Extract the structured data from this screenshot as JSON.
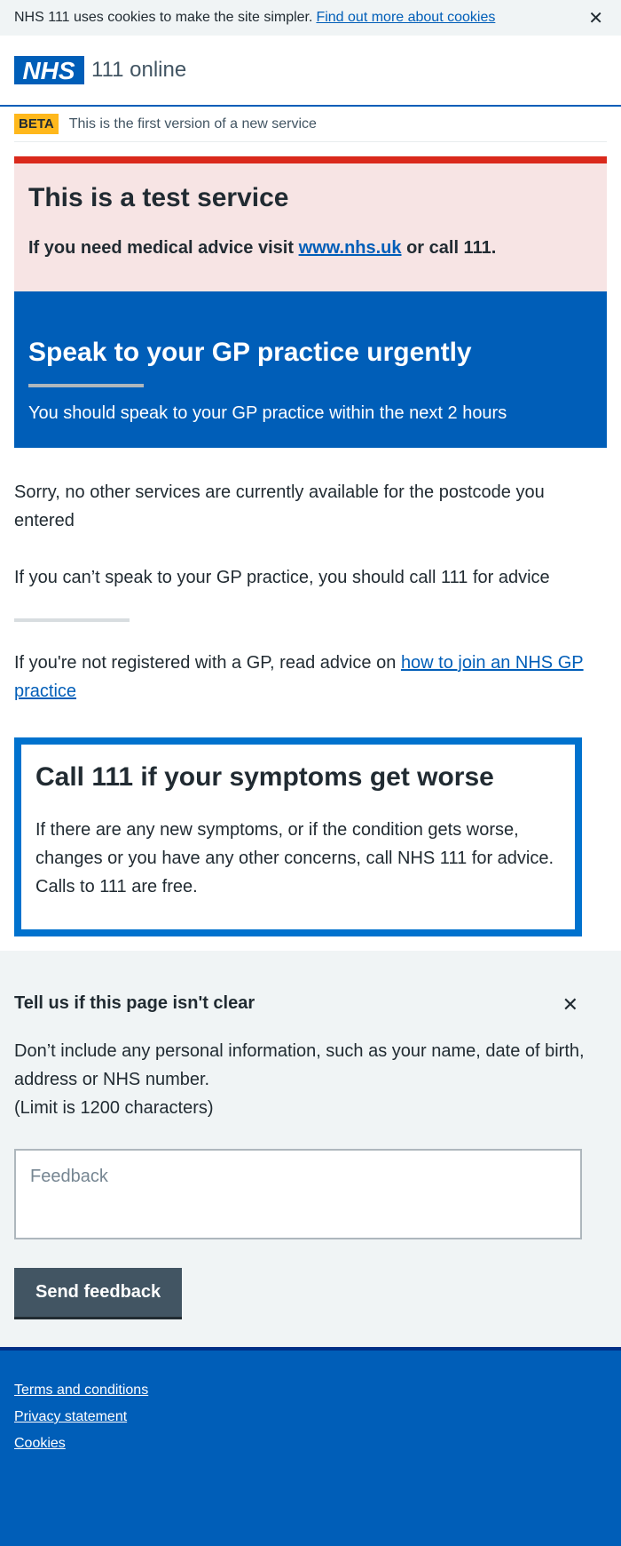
{
  "cookie_banner": {
    "text": "NHS 111 uses cookies to make the site simpler.",
    "link": "Find out more about cookies",
    "close": "✕"
  },
  "header": {
    "logo_text": "NHS",
    "service_name": "111 online"
  },
  "beta": {
    "tag": "BETA",
    "text": "This is the first version of a new service"
  },
  "test_banner": {
    "title": "This is a test service",
    "text_before": "If you need medical advice visit",
    "link": "www.nhs.uk",
    "text_after": "or call 111."
  },
  "care_card": {
    "title": "Speak to your GP practice urgently",
    "text": "You should speak to your GP practice within the next 2 hours"
  },
  "content": {
    "para1": "Sorry, no other services are currently available for the postcode you entered",
    "para2": "If you can’t speak to your GP practice, you should call 111 for advice",
    "para3_before": "If you're not registered with a GP, read advice on",
    "para3_link": "how to join an NHS GP practice"
  },
  "worse_box": {
    "title": "Call 111 if your symptoms get worse",
    "text": "If there are any new symptoms, or if the condition gets worse, changes or you have any other concerns, call NHS 111 for advice. Calls to 111 are free."
  },
  "feedback": {
    "title": "Tell us if this page isn't clear",
    "close": "✕",
    "info_line1": "Don’t include any personal information, such as your name, date of birth, address or NHS number.",
    "info_line2": "(Limit is 1200 characters)",
    "placeholder": "Feedback",
    "button": "Send feedback"
  },
  "footer": {
    "links": [
      "Terms and conditions",
      "Privacy statement",
      "Cookies"
    ]
  },
  "colors": {
    "nhs_blue": "#005eb8",
    "emergency_red": "#da291c",
    "beta_yellow": "#ffb81c",
    "care_border_blue": "#0072ce",
    "button_grey": "#425563"
  }
}
